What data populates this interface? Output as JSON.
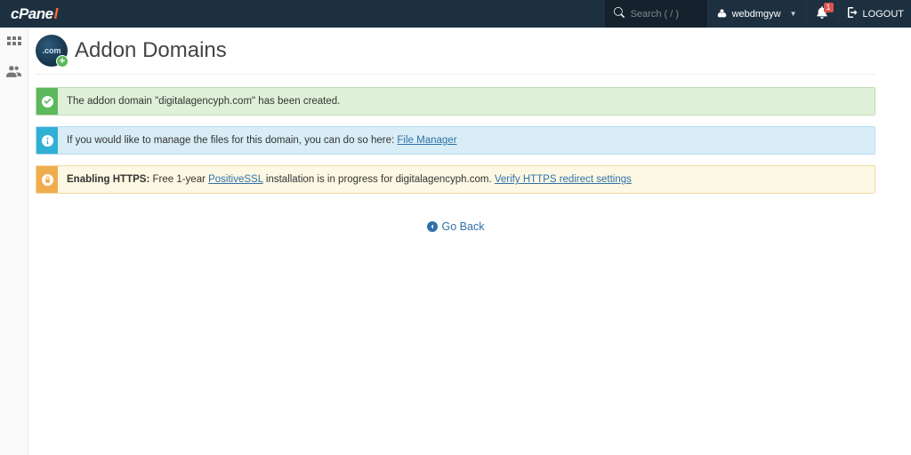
{
  "header": {
    "logo_text": "cPanel",
    "search_placeholder": "Search ( / )",
    "username": "webdmgyw",
    "notif_count": "1",
    "logout_label": "LOGOUT"
  },
  "page": {
    "icon_text": ".com",
    "title": "Addon Domains"
  },
  "alerts": {
    "success_text": "The addon domain \"digitalagencyph.com\" has been created.",
    "info_text_prefix": "If you would like to manage the files for this domain, you can do so here: ",
    "info_link": "File Manager",
    "warn_strong": "Enabling HTTPS:",
    "warn_mid1": " Free 1-year ",
    "warn_link1": "PositiveSSL",
    "warn_mid2": " installation is in progress for digitalagencyph.com. ",
    "warn_link2": "Verify HTTPS redirect settings"
  },
  "nav": {
    "go_back": "Go Back"
  }
}
